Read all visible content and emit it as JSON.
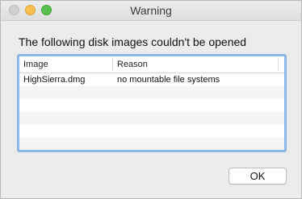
{
  "window": {
    "title": "Warning"
  },
  "dialog": {
    "message": "The following disk images couldn't be opened",
    "table": {
      "columns": [
        "Image",
        "Reason"
      ],
      "rows": [
        {
          "image": "HighSierra.dmg",
          "reason": "no mountable file systems"
        }
      ]
    },
    "ok_label": "OK"
  },
  "colors": {
    "window_bg": "#ececec",
    "focus_ring": "#8db6e9",
    "close": "#d0d0d0",
    "minimize": "#f6bf50",
    "maximize": "#5bc04f"
  }
}
